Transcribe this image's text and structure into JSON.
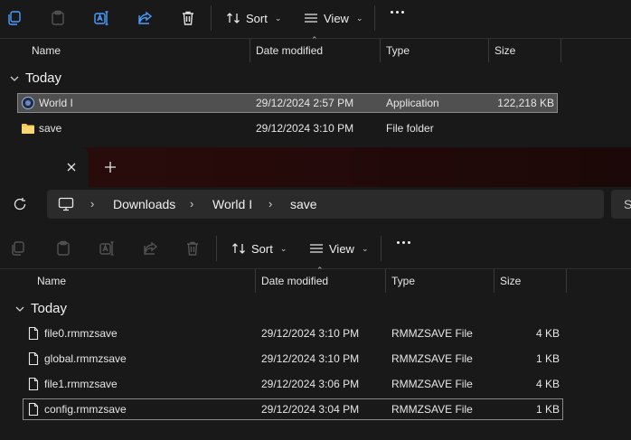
{
  "back_window": {
    "toolbar": {
      "sort_label": "Sort",
      "view_label": "View"
    },
    "columns": {
      "name": "Name",
      "date": "Date modified",
      "type": "Type",
      "size": "Size"
    },
    "group_label": "Today",
    "rows": [
      {
        "name": "World I",
        "date": "29/12/2024 2:57 PM",
        "type": "Application",
        "size": "122,218 KB",
        "icon": "application-icon",
        "selected": true
      },
      {
        "name": "save",
        "date": "29/12/2024 3:10 PM",
        "type": "File folder",
        "size": "",
        "icon": "folder-icon",
        "selected": false
      }
    ]
  },
  "front_window": {
    "tab": {
      "close_icon": "close-icon",
      "new_tab_icon": "plus-icon"
    },
    "address": {
      "crumbs": [
        "Downloads",
        "World I",
        "save"
      ],
      "search_partial": "S"
    },
    "toolbar": {
      "sort_label": "Sort",
      "view_label": "View"
    },
    "columns": {
      "name": "Name",
      "date": "Date modified",
      "type": "Type",
      "size": "Size"
    },
    "group_label": "Today",
    "rows": [
      {
        "name": "file0.rmmzsave",
        "date": "29/12/2024 3:10 PM",
        "type": "RMMZSAVE File",
        "size": "4 KB"
      },
      {
        "name": "global.rmmzsave",
        "date": "29/12/2024 3:10 PM",
        "type": "RMMZSAVE File",
        "size": "1 KB"
      },
      {
        "name": "file1.rmmzsave",
        "date": "29/12/2024 3:06 PM",
        "type": "RMMZSAVE File",
        "size": "4 KB"
      },
      {
        "name": "config.rmmzsave",
        "date": "29/12/2024 3:04 PM",
        "type": "RMMZSAVE File",
        "size": "1 KB",
        "focused": true
      }
    ]
  },
  "colors": {
    "background": "#191919",
    "selection": "#505050",
    "folder": "#f2c94c",
    "tabstrip": "#2a0c0c"
  }
}
